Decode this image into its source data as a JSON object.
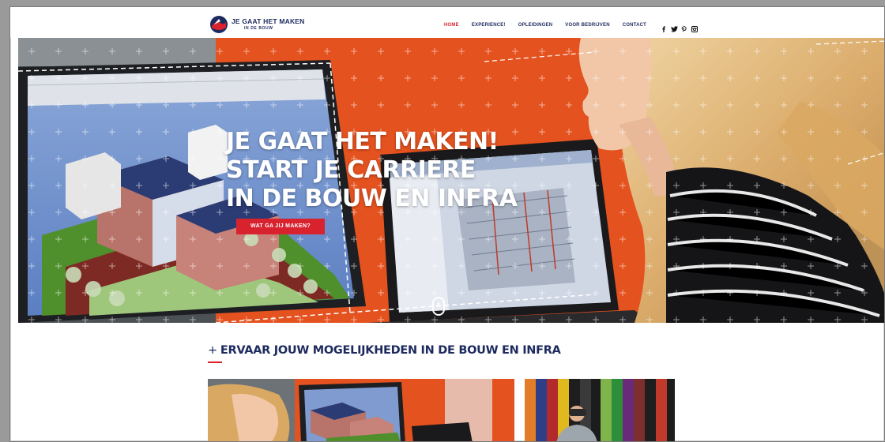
{
  "brand": {
    "title": "JE GAAT HET MAKEN",
    "subtitle": "IN DE BOUW"
  },
  "nav": {
    "items": [
      {
        "label": "HOME",
        "active": true
      },
      {
        "label": "EXPERIENCE!",
        "active": false
      },
      {
        "label": "OPLEIDINGEN",
        "active": false
      },
      {
        "label": "VOOR BEDRIJVEN",
        "active": false
      },
      {
        "label": "CONTACT",
        "active": false
      }
    ],
    "social": [
      "facebook-icon",
      "twitter-icon",
      "pinterest-icon",
      "instagram-icon"
    ]
  },
  "hero": {
    "line1": "JE GAAT HET MAKEN!",
    "line2": "START JE CARRIERE",
    "line3": "IN DE BOUW EN INFRA",
    "cta": "WAT GA JIJ MAKEN?"
  },
  "section": {
    "title": "ERVAAR JOUW MOGELIJKHEDEN IN DE BOUW EN INFRA"
  },
  "colors": {
    "accent": "#d8232f",
    "navy": "#1d2a5e",
    "hero_bg": "#e4521f"
  }
}
